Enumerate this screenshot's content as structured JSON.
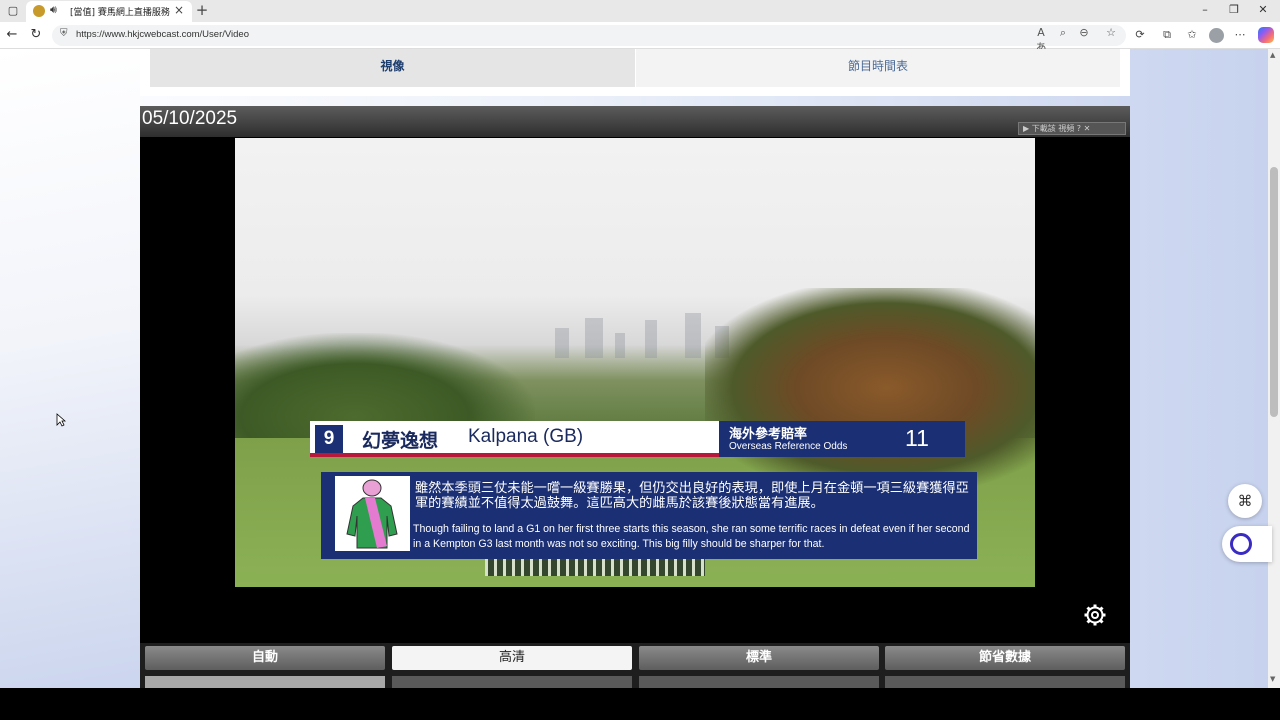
{
  "browser": {
    "tab_title": "[當值] 賽馬網上直播服務",
    "new_tab": "+",
    "url": "https://www.hkjcwebcast.com/User/Video",
    "window_controls": [
      "–",
      "❐",
      "✕"
    ]
  },
  "page": {
    "tabs": [
      {
        "label": "視像",
        "active": true
      },
      {
        "label": "節目時間表",
        "active": false
      }
    ],
    "player": {
      "date": "05/10/2025",
      "download_label": "▶ 下載該 視頻 ? ✕",
      "overlay": {
        "number": "9",
        "horse_name_zh": "幻夢逸想",
        "horse_name_en": "Kalpana (GB)",
        "odds_label_zh": "海外參考賠率",
        "odds_label_en": "Overseas Reference Odds",
        "odds_value": "11",
        "comment_zh": "雖然本季頭三仗未能一嚐一級賽勝果，但仍交出良好的表現，即使上月在金頓一項三級賽獲得亞軍的賽績並不值得太過鼓舞。這匹高大的雌馬於該賽後狀態當有進展。",
        "comment_en": "Though failing to land a G1 on her first three starts this season, she ran some terrific races in defeat even if her second in a Kempton G3 last month was not so exciting. This big filly should be sharper for that."
      },
      "quality_buttons": [
        {
          "label": "自動",
          "selected": false
        },
        {
          "label": "高清",
          "selected": true
        },
        {
          "label": "標準",
          "selected": false
        },
        {
          "label": "節省數據",
          "selected": false
        }
      ]
    }
  },
  "colors": {
    "overlay_navy": "#1b2f74",
    "overlay_red": "#b8183a",
    "tab_text": "#2f4f7f"
  }
}
